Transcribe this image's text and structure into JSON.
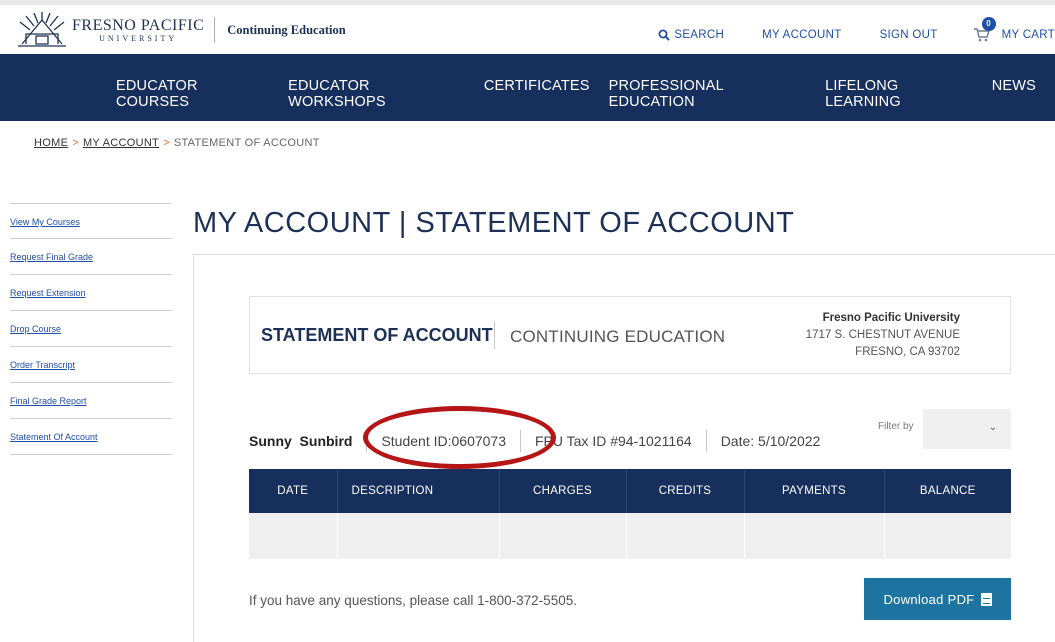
{
  "header": {
    "logo_name": "FRESNO PACIFIC",
    "logo_sub": "UNIVERSITY",
    "division": "Continuing Education",
    "search_label": "SEARCH",
    "my_account_label": "MY ACCOUNT",
    "sign_out_label": "SIGN OUT",
    "cart_count": "0",
    "cart_label": "MY CART"
  },
  "nav": {
    "items": [
      "EDUCATOR COURSES",
      "EDUCATOR WORKSHOPS",
      "CERTIFICATES",
      "PROFESSIONAL EDUCATION",
      "LIFELONG LEARNING",
      "NEWS"
    ]
  },
  "breadcrumb": {
    "home": "HOME",
    "sep": ">",
    "my_account": "MY ACCOUNT",
    "current": "STATEMENT OF ACCOUNT"
  },
  "sidebar": {
    "items": [
      "View My Courses",
      "Request Final Grade",
      "Request Extension",
      "Drop Course",
      "Order Transcript",
      "Final Grade Report",
      "Statement Of Account"
    ]
  },
  "page": {
    "title": "MY ACCOUNT | STATEMENT OF ACCOUNT"
  },
  "statement": {
    "title": "STATEMENT OF ACCOUNT",
    "subtitle": "CONTINUING EDUCATION",
    "org": "Fresno Pacific University",
    "address1": "1717 S. CHESTNUT AVENUE",
    "address2": "FRESNO, CA 93702"
  },
  "info": {
    "name": "Sunny  Sunbird",
    "student_id": "Student ID:0607073",
    "tax_id": "FPU Tax ID #94-1021164",
    "date": "Date: 5/10/2022",
    "filter_label": "Filter by"
  },
  "table": {
    "headers": [
      "DATE",
      "DESCRIPTION",
      "CHARGES",
      "CREDITS",
      "PAYMENTS",
      "BALANCE"
    ]
  },
  "footer": {
    "questions": "If you have any questions, please call 1-800-372-5505.",
    "download_label": "Download PDF"
  },
  "colors": {
    "navy": "#172f5c",
    "link_blue": "#1f4fa8",
    "button_blue": "#1e74a0",
    "highlight_red": "#b51515"
  }
}
